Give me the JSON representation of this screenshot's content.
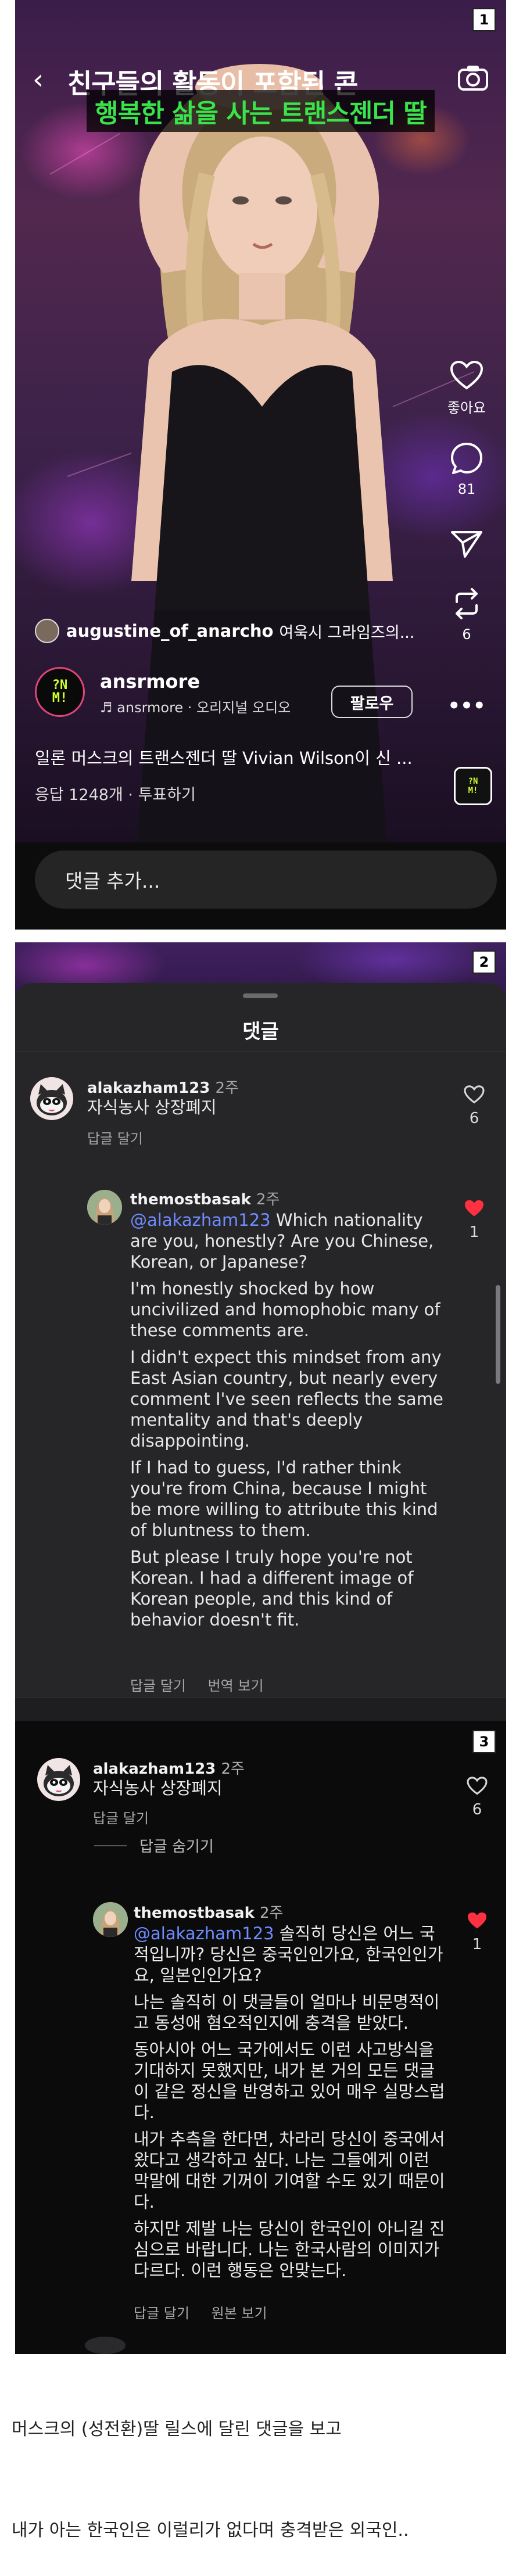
{
  "panel1": {
    "badge": "1",
    "reel_title": "친구들의 활동이 포함된 콘",
    "reel_caption": "행복한 삶을 사는 트랜스젠더 딸",
    "actions": {
      "like_label": "좋아요",
      "comment_count": "81",
      "repost_count": "6"
    },
    "audio": {
      "user": "augustine_of_anarcho",
      "text": "여욱시 그라임즈의..."
    },
    "author": {
      "avatar_text": "?N\nM!",
      "name": "ansrmore",
      "sub": "♬ ansrmore · 오리지널 오디오",
      "follow_label": "팔로우"
    },
    "description": "일론 머스크의 트랜스젠더 딸 Vivian Wilson이 신 ...",
    "meta": "응답 1248개 · 투표하기",
    "music_thumb_text": "?N\nM!",
    "comment_placeholder": "댓글 추가..."
  },
  "panel2": {
    "badge": "2",
    "sheet_title": "댓글",
    "comment1": {
      "user": "alakazham123",
      "time": "2주",
      "text": "자식농사 상장폐지",
      "reply_label": "답글 달기",
      "like_count": "6"
    },
    "reply1": {
      "user": "themostbasak",
      "time": "2주",
      "mention": "@alakazham123",
      "paragraphs": [
        " Which nationality are you, honestly? Are you Chinese, Korean, or Japanese?",
        "I'm honestly shocked by how uncivilized and homophobic many of these comments are.",
        "I didn't expect this mindset from any East Asian country, but nearly every comment I've seen reflects the same mentality and that's deeply disappointing.",
        "If I had to guess, I'd rather think you're from China, because I might be more willing to attribute this kind of bluntness to them.",
        "But please I truly hope you're not Korean. I had a different image of Korean people, and this kind of behavior doesn't fit."
      ],
      "reply_label": "답글 달기",
      "translate_label": "번역 보기",
      "like_count": "1"
    },
    "emojis": [
      "❤️",
      "🙌",
      "🔥",
      "👏",
      "😢",
      "😍",
      "😮",
      "😂"
    ]
  },
  "panel3": {
    "badge": "3",
    "comment1": {
      "user": "alakazham123",
      "time": "2주",
      "text": "자식농사 상장폐지",
      "reply_label": "답글 달기",
      "like_count": "6"
    },
    "hide_replies_label": "답글 숨기기",
    "reply1": {
      "user": "themostbasak",
      "time": "2주",
      "mention": "@alakazham123",
      "paragraphs": [
        " 솔직히 당신은 어느 국적입니까? 당신은 중국인인가요, 한국인인가요, 일본인인가요?",
        "나는 솔직히 이 댓글들이 얼마나 비문명적이고 동성애 혐오적인지에 충격을 받았다.",
        "동아시아 어느 국가에서도 이런 사고방식을 기대하지 못했지만, 내가 본 거의 모든 댓글이 같은 정신을 반영하고 있어 매우 실망스럽다.",
        "내가 추측을 한다면, 차라리 당신이 중국에서 왔다고 생각하고 싶다. 나는 그들에게 이런 막말에 대한 기꺼이 기여할 수도 있기 때문이다.",
        "하지만 제발 나는 당신이 한국인이 아니길 진심으로 바랍니다. 나는 한국사람의 이미지가 다르다. 이런 행동은 안맞는다."
      ],
      "reply_label": "답글 달기",
      "original_label": "원본 보기",
      "like_count": "1"
    }
  },
  "captions": {
    "line1": "머스크의 (성전환)딸 릴스에 달린 댓글을 보고",
    "line2": "내가 아는 한국인은 이럴리가 없다며 충격받은 외국인.."
  },
  "colors": {
    "like_red": "#ff3040",
    "mention_blue": "#6f8cff",
    "caption_green": "#39e34a"
  }
}
